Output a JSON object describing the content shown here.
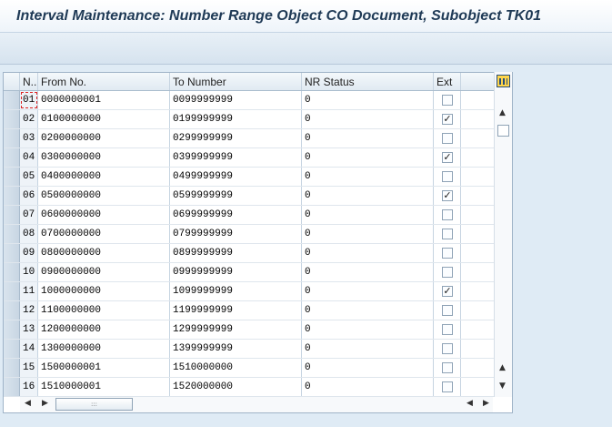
{
  "window": {
    "title": "Interval Maintenance: Number Range Object CO Document, Subobject TK01"
  },
  "table": {
    "columns": {
      "n": "N..",
      "from": "From No.",
      "to": "To Number",
      "status": "NR Status",
      "ext": "Ext"
    },
    "rows": [
      {
        "n": "01",
        "from": "0000000001",
        "to": "0099999999",
        "status": "0",
        "ext": ""
      },
      {
        "n": "02",
        "from": "0100000000",
        "to": "0199999999",
        "status": "0",
        "ext": "✓"
      },
      {
        "n": "03",
        "from": "0200000000",
        "to": "0299999999",
        "status": "0",
        "ext": ""
      },
      {
        "n": "04",
        "from": "0300000000",
        "to": "0399999999",
        "status": "0",
        "ext": "✓"
      },
      {
        "n": "05",
        "from": "0400000000",
        "to": "0499999999",
        "status": "0",
        "ext": ""
      },
      {
        "n": "06",
        "from": "0500000000",
        "to": "0599999999",
        "status": "0",
        "ext": "✓"
      },
      {
        "n": "07",
        "from": "0600000000",
        "to": "0699999999",
        "status": "0",
        "ext": ""
      },
      {
        "n": "08",
        "from": "0700000000",
        "to": "0799999999",
        "status": "0",
        "ext": ""
      },
      {
        "n": "09",
        "from": "0800000000",
        "to": "0899999999",
        "status": "0",
        "ext": ""
      },
      {
        "n": "10",
        "from": "0900000000",
        "to": "0999999999",
        "status": "0",
        "ext": ""
      },
      {
        "n": "11",
        "from": "1000000000",
        "to": "1099999999",
        "status": "0",
        "ext": "✓"
      },
      {
        "n": "12",
        "from": "1100000000",
        "to": "1199999999",
        "status": "0",
        "ext": ""
      },
      {
        "n": "13",
        "from": "1200000000",
        "to": "1299999999",
        "status": "0",
        "ext": ""
      },
      {
        "n": "14",
        "from": "1300000000",
        "to": "1399999999",
        "status": "0",
        "ext": ""
      },
      {
        "n": "15",
        "from": "1500000001",
        "to": "1510000000",
        "status": "0",
        "ext": ""
      },
      {
        "n": "16",
        "from": "1510000001",
        "to": "1520000000",
        "status": "0",
        "ext": ""
      }
    ]
  },
  "scroll": {
    "up": "▲",
    "down": "▼",
    "left": "◀",
    "right": "▶",
    "thumb_grip": ":::"
  },
  "icons": {
    "layout": "table-layout-icon"
  }
}
